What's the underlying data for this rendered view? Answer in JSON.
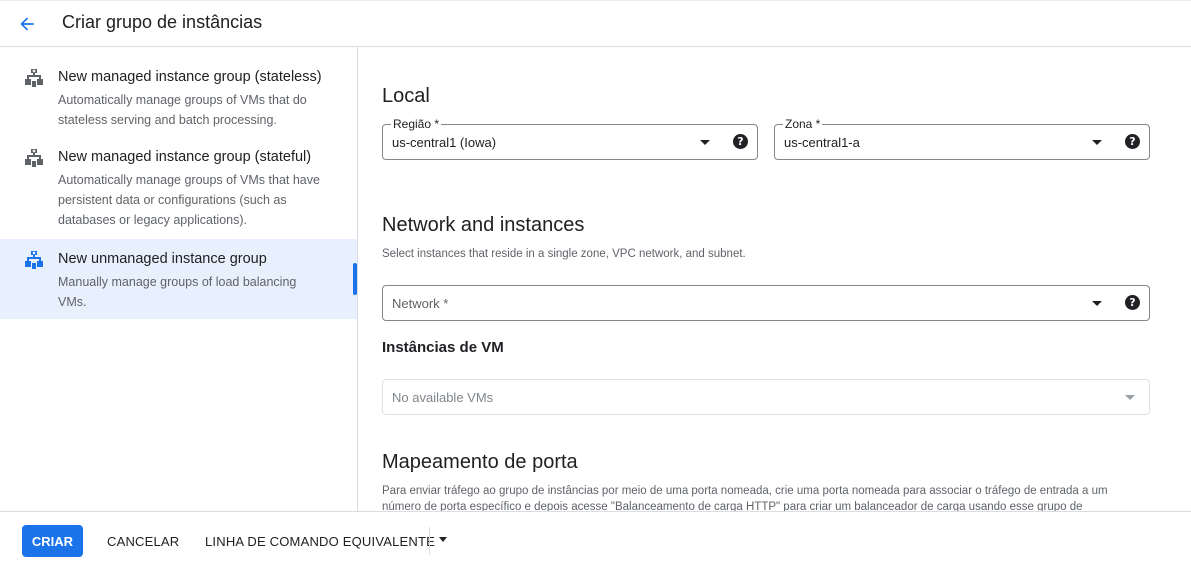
{
  "header": {
    "title": "Criar grupo de instâncias",
    "back_icon": "arrow-back-icon"
  },
  "sidebar": {
    "items": [
      {
        "title": "New managed instance group (stateless)",
        "desc_lines": [
          "Automatically manage groups of VMs that do",
          "stateless serving and batch processing."
        ],
        "icon": "instance-group-icon",
        "selected": false
      },
      {
        "title": "New managed instance group (stateful)",
        "desc_lines": [
          "Automatically manage groups of VMs that have",
          "persistent data or configurations (such as",
          "databases or legacy applications)."
        ],
        "icon": "instance-group-icon",
        "selected": false
      },
      {
        "title": "New unmanaged instance group",
        "desc_lines": [
          "Manually manage groups of load balancing",
          "VMs."
        ],
        "icon": "instance-group-icon",
        "selected": true
      }
    ]
  },
  "main": {
    "local": {
      "title": "Local",
      "region": {
        "label": "Região *",
        "value": "us-central1 (Iowa)"
      },
      "zone": {
        "label": "Zona *",
        "value": "us-central1-a"
      }
    },
    "network_section": {
      "title": "Network and instances",
      "helper": "Select instances that reside in a single zone, VPC network, and subnet.",
      "network": {
        "placeholder": "Network *"
      },
      "vm_title": "Instâncias de VM",
      "vm_select": {
        "placeholder": "No available VMs"
      }
    },
    "port_section": {
      "title": "Mapeamento de porta",
      "text_lines": [
        "Para enviar tráfego ao grupo de instâncias por meio de uma porta nomeada, crie uma porta nomeada para associar o tráfego de entrada a um",
        "número de porta específico e depois acesse \"Balanceamento de carga HTTP\" para criar um balanceador de carga usando esse grupo de"
      ]
    }
  },
  "footer": {
    "create_label": "CRIAR",
    "cancel_label": "CANCELAR",
    "cli_label": "LINHA DE COMANDO EQUIVALENTE"
  },
  "colors": {
    "accent": "#1a73e8",
    "selected_bg": "#e8f0fe",
    "icon_color": "#5f6368",
    "selected_icon_color": "#1a73e8"
  }
}
